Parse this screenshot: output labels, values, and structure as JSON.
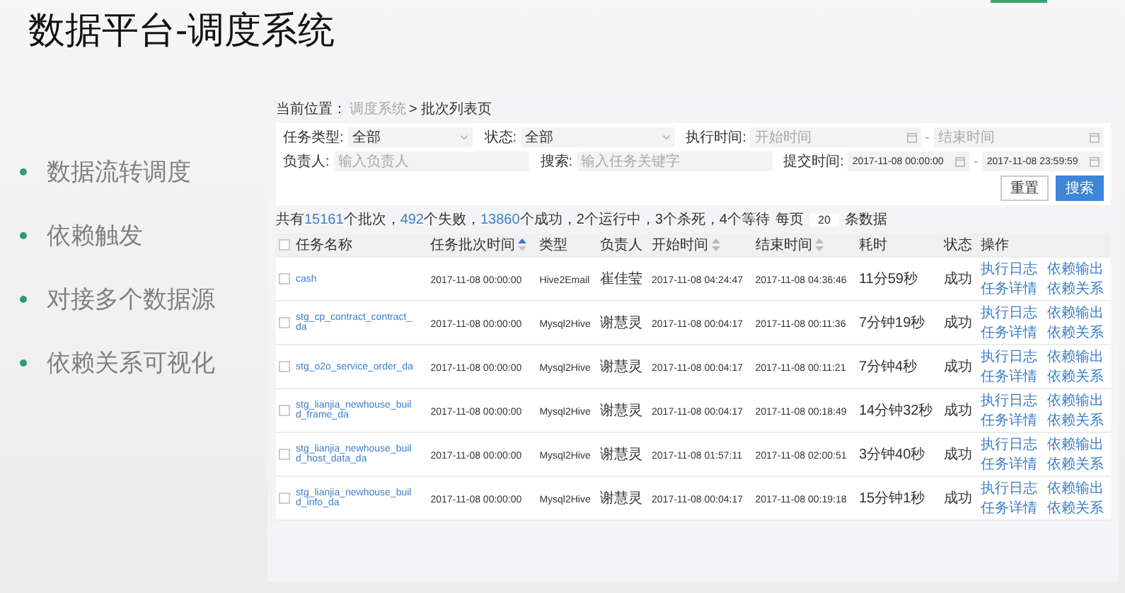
{
  "slide": {
    "title": "数据平台-调度系统",
    "bullets": [
      "数据流转调度",
      "依赖触发",
      "对接多个数据源",
      "依赖关系可视化"
    ]
  },
  "app": {
    "breadcrumb": [
      {
        "text": "当前位置：",
        "kind": "label"
      },
      {
        "text": "调度系统",
        "kind": "link"
      },
      {
        "text": "> 批次列表页",
        "kind": "current"
      }
    ],
    "filters": [
      [
        {
          "label": "任务类型:",
          "kind": "select",
          "value": "全部"
        },
        {
          "label": "状态:",
          "kind": "select",
          "value": "全部"
        },
        {
          "label": "执行时间:",
          "kind": "range",
          "separator": "-",
          "from": {
            "placeholder": "开始时间"
          },
          "to": {
            "placeholder": "结束时间"
          }
        }
      ],
      [
        {
          "label": "负责人:",
          "kind": "text",
          "placeholder": "输入负责人"
        },
        {
          "label": "搜索:",
          "kind": "text",
          "placeholder": "输入任务关键字"
        },
        {
          "label": "提交时间:",
          "kind": "range",
          "separator": "-",
          "from": {
            "value": "2017-11-08 00:00:00"
          },
          "to": {
            "value": "2017-11-08 23:59:59"
          }
        }
      ]
    ],
    "buttons": [
      {
        "label": "重置",
        "primary": false
      },
      {
        "label": "搜索",
        "primary": true
      }
    ],
    "summary": [
      {
        "text": "共有",
        "highlight": false
      },
      {
        "text": "15161",
        "highlight": true
      },
      {
        "text": "个批次，",
        "highlight": false
      },
      {
        "text": "492",
        "highlight": true
      },
      {
        "text": "个失败，",
        "highlight": false
      },
      {
        "text": "13860",
        "highlight": true
      },
      {
        "text": "个成功，2个运行中，3个杀死，4个等待",
        "highlight": false
      }
    ],
    "page_size": {
      "prefix": "每页",
      "value": "20",
      "suffix": "条数据"
    },
    "table": {
      "header_checkbox": {
        "checked": false
      },
      "columns": [
        {
          "label": "任务名称"
        },
        {
          "label": "任务批次时间",
          "sorted": true
        },
        {
          "label": "类型"
        },
        {
          "label": "负责人"
        },
        {
          "label": "开始时间",
          "sorted": false
        },
        {
          "label": "结束时间",
          "sorted": false
        },
        {
          "label": "耗时"
        },
        {
          "label": "状态"
        },
        {
          "label": "操作"
        }
      ],
      "rows": [
        {
          "checked": false,
          "name": "cash",
          "batch_time": "2017-11-08 00:00:00",
          "type": "Hive2Email",
          "owner": "崔佳莹",
          "start": "2017-11-08 04:24:47",
          "end": "2017-11-08 04:36:46",
          "duration": "11分59秒",
          "status": "成功",
          "actions": [
            "执行日志",
            "依赖输出",
            "任务详情",
            "依赖关系"
          ]
        },
        {
          "checked": false,
          "name": "stg_cp_contract_contract_da",
          "batch_time": "2017-11-08 00:00:00",
          "type": "Mysql2Hive",
          "owner": "谢慧灵",
          "start": "2017-11-08 00:04:17",
          "end": "2017-11-08 00:11:36",
          "duration": "7分钟19秒",
          "status": "成功",
          "actions": [
            "执行日志",
            "依赖输出",
            "任务详情",
            "依赖关系"
          ]
        },
        {
          "checked": false,
          "name": "stg_o2o_service_order_da",
          "batch_time": "2017-11-08 00:00:00",
          "type": "Mysql2Hive",
          "owner": "谢慧灵",
          "start": "2017-11-08 00:04:17",
          "end": "2017-11-08 00:11:21",
          "duration": "7分钟4秒",
          "status": "成功",
          "actions": [
            "执行日志",
            "依赖输出",
            "任务详情",
            "依赖关系"
          ]
        },
        {
          "checked": false,
          "name": "stg_lianjia_newhouse_build_frame_da",
          "batch_time": "2017-11-08 00:00:00",
          "type": "Mysql2Hive",
          "owner": "谢慧灵",
          "start": "2017-11-08 00:04:17",
          "end": "2017-11-08 00:18:49",
          "duration": "14分钟32秒",
          "status": "成功",
          "actions": [
            "执行日志",
            "依赖输出",
            "任务详情",
            "依赖关系"
          ]
        },
        {
          "checked": false,
          "name": "stg_lianjia_newhouse_build_host_data_da",
          "batch_time": "2017-11-08 00:00:00",
          "type": "Mysql2Hive",
          "owner": "谢慧灵",
          "start": "2017-11-08 01:57:11",
          "end": "2017-11-08 02:00:51",
          "duration": "3分钟40秒",
          "status": "成功",
          "actions": [
            "执行日志",
            "依赖输出",
            "任务详情",
            "依赖关系"
          ]
        },
        {
          "checked": false,
          "name": "stg_lianjia_newhouse_build_info_da",
          "batch_time": "2017-11-08 00:00:00",
          "type": "Mysql2Hive",
          "owner": "谢慧灵",
          "start": "2017-11-08 00:04:17",
          "end": "2017-11-08 00:19:18",
          "duration": "15分钟1秒",
          "status": "成功",
          "actions": [
            "执行日志",
            "依赖输出",
            "任务详情",
            "依赖关系"
          ]
        }
      ]
    }
  }
}
